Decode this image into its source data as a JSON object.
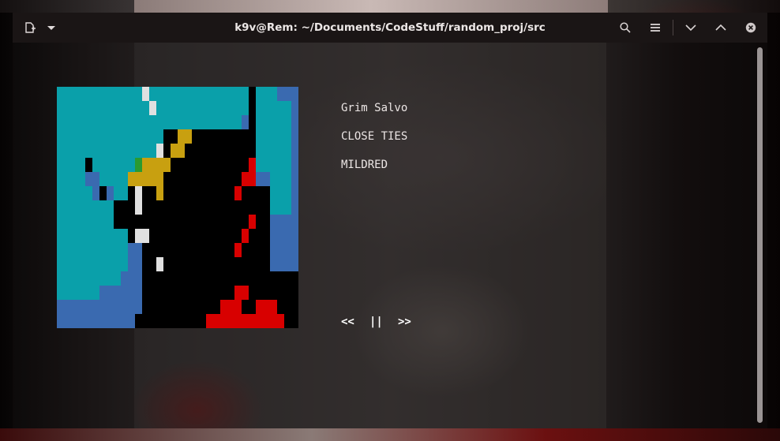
{
  "window": {
    "title": "k9v@Rem: ~/Documents/CodeStuff/random_proj/src",
    "icons": {
      "new_tab": "new-tab-icon",
      "menu_dropdown": "chevron-down-icon",
      "search": "search-icon",
      "hamburger": "hamburger-menu-icon",
      "minimize": "minimize-chevron-icon",
      "maximize": "maximize-chevron-icon",
      "close": "close-icon"
    }
  },
  "player": {
    "artist": "Grim Salvo",
    "album": "CLOSE TIES",
    "track": "MILDRED",
    "controls": {
      "prev": "<<",
      "pause": "||",
      "next": ">>"
    }
  },
  "colors": {
    "teal": "#0aa0aa",
    "blue": "#3a6ab0",
    "gold": "#c8a010",
    "green": "#2a9a30",
    "red": "#d80000",
    "white": "#e0e0e0",
    "black": "#000000"
  }
}
